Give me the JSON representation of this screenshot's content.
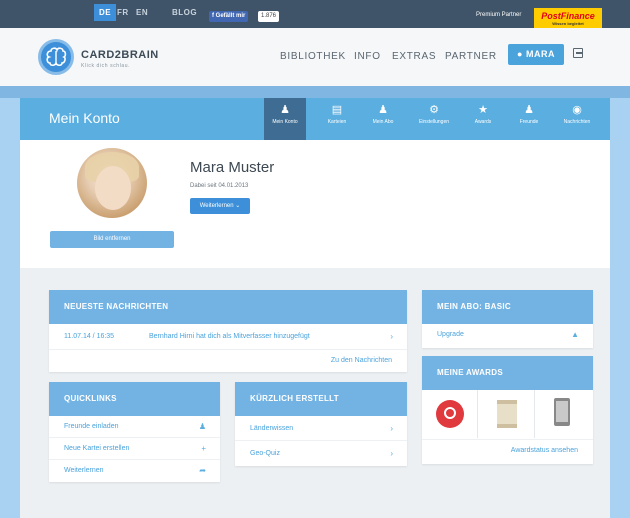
{
  "topbar": {
    "languages": [
      "DE",
      "FR",
      "EN"
    ],
    "blog": "BLOG",
    "facebook_like": "Gefällt mir",
    "facebook_count": "1.876",
    "premium_partner": "Premium Partner",
    "partner_logo": "PostFinance",
    "partner_slogan": "Wissen begleitet"
  },
  "header": {
    "brand": "CARD2BRAIN",
    "slogan": "Klick dich schlau.",
    "nav": [
      "BIBLIOTHEK",
      "INFO",
      "EXTRAS",
      "PARTNER"
    ],
    "user": "MARA"
  },
  "account": {
    "title": "Mein Konto",
    "tabs": [
      {
        "label": "Mein Konto",
        "icon": "user-icon"
      },
      {
        "label": "Karteien",
        "icon": "cards-icon"
      },
      {
        "label": "Mein Abo",
        "icon": "subscription-icon"
      },
      {
        "label": "Einstellungen",
        "icon": "gear-icon"
      },
      {
        "label": "Awards",
        "icon": "trophy-icon"
      },
      {
        "label": "Freunde",
        "icon": "friends-icon"
      },
      {
        "label": "Nachrichten",
        "icon": "chat-icon"
      }
    ]
  },
  "profile": {
    "name": "Mara Muster",
    "since": "Dabei seit 04.01.2013",
    "learn_button": "Weiterlernen",
    "remove_image": "Bild entfernen"
  },
  "news": {
    "title": "NEUESTE NACHRICHTEN",
    "items": [
      {
        "date": "11.07.14 / 16:35",
        "text": "Bernhard Hirni hat dich als Mitverfasser hinzugefügt"
      }
    ],
    "link": "Zu den Nachrichten"
  },
  "quicklinks": {
    "title": "QUICKLINKS",
    "items": [
      "Freunde einladen",
      "Neue Kartei erstellen",
      "Weiterlernen"
    ]
  },
  "recent": {
    "title": "KÜRZLICH ERSTELLT",
    "items": [
      "Länderwissen",
      "Geo-Quiz"
    ]
  },
  "subscription": {
    "title": "MEIN ABO: BASIC",
    "upgrade": "Upgrade"
  },
  "awards": {
    "title": "MEINE AWARDS",
    "link": "Awardstatus ansehen"
  }
}
